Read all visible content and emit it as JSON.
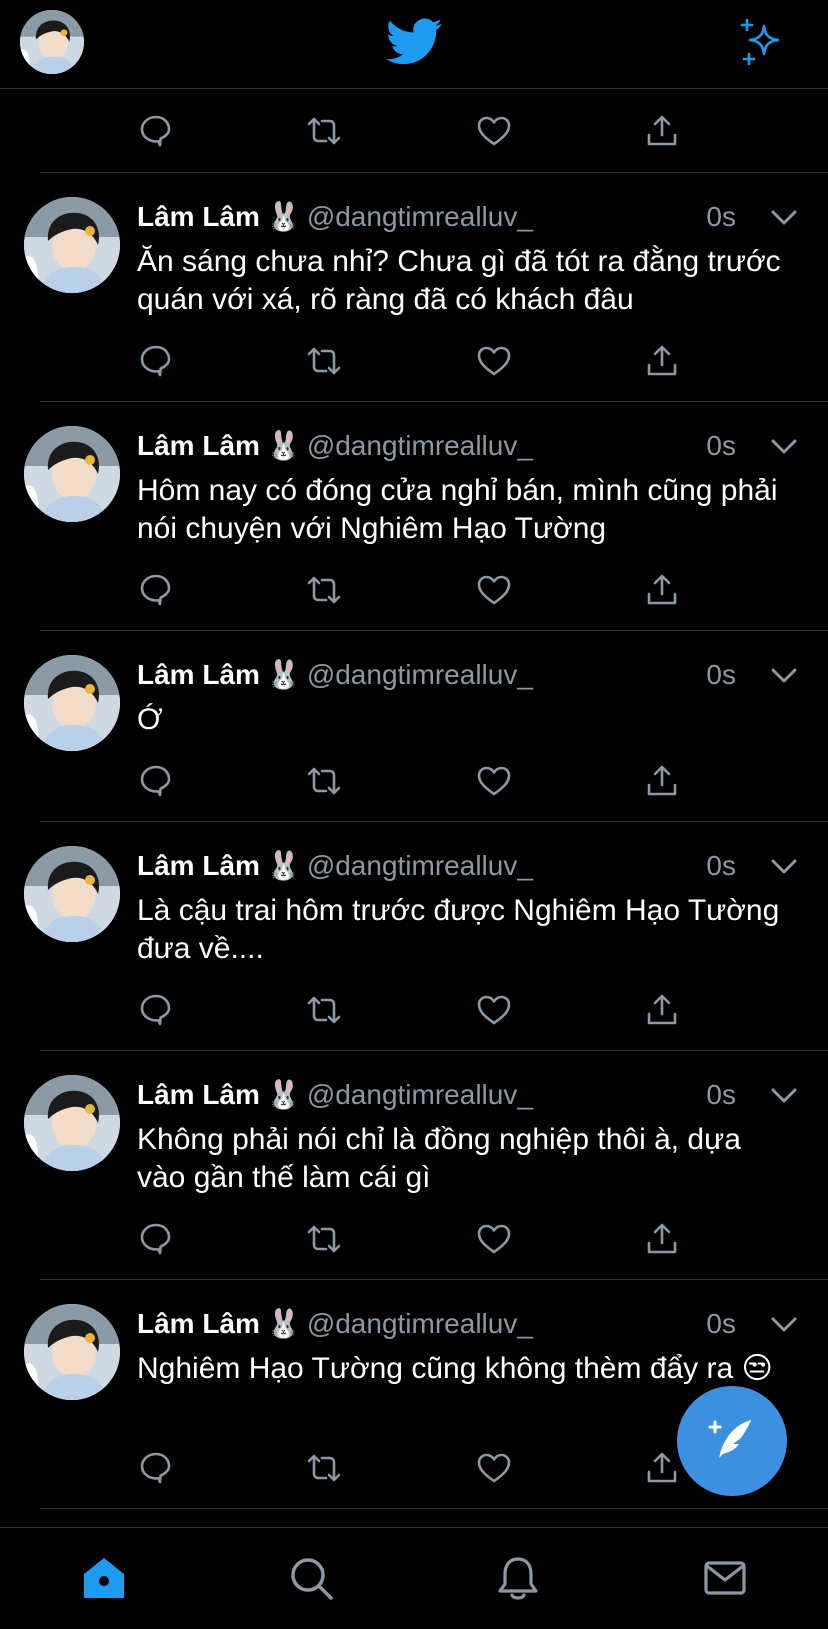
{
  "colors": {
    "accent": "#1d9bf0",
    "icon_gray": "#8b98a5",
    "background": "#000000",
    "divider": "#2f3336",
    "fab": "#3d8fe0"
  },
  "header": {
    "logo_icon": "twitter-bird-icon",
    "right_icon": "sparkle-icon"
  },
  "tweets": [
    {
      "name": "Lâm Lâm",
      "emoji": "🐰",
      "handle": "@dangtimrealluv_",
      "time": "0s",
      "text": "Ăn sáng chưa nhỉ? Chưa gì đã tót ra đằng trước quán với xá, rõ ràng đã có khách đâu"
    },
    {
      "name": "Lâm Lâm",
      "emoji": "🐰",
      "handle": "@dangtimrealluv_",
      "time": "0s",
      "text": "Hôm nay có đóng cửa nghỉ bán, mình cũng phải nói chuyện với Nghiêm Hạo Tường"
    },
    {
      "name": "Lâm Lâm",
      "emoji": "🐰",
      "handle": "@dangtimrealluv_",
      "time": "0s",
      "text": "Ớ"
    },
    {
      "name": "Lâm Lâm",
      "emoji": "🐰",
      "handle": "@dangtimrealluv_",
      "time": "0s",
      "text": "Là cậu trai hôm trước được Nghiêm Hạo Tường đưa về...."
    },
    {
      "name": "Lâm Lâm",
      "emoji": "🐰",
      "handle": "@dangtimrealluv_",
      "time": "0s",
      "text": "Không phải nói chỉ là đồng nghiệp thôi à, dựa vào gần thế làm cái gì"
    },
    {
      "name": "Lâm Lâm",
      "emoji": "🐰",
      "handle": "@dangtimrealluv_",
      "time": "0s",
      "text": "Nghiêm Hạo Tường cũng không thèm đẩy ra 😒"
    }
  ],
  "bottom_nav": [
    "home-icon",
    "search-icon",
    "notifications-icon",
    "messages-icon"
  ],
  "fab": {
    "icon": "compose-tweet-icon"
  }
}
